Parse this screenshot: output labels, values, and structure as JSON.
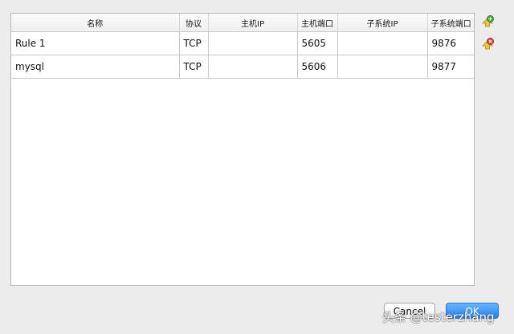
{
  "table": {
    "columns": [
      "名称",
      "协议",
      "主机IP",
      "主机端口",
      "子系统IP",
      "子系统端口"
    ],
    "rows": [
      {
        "name": "Rule 1",
        "protocol": "TCP",
        "host_ip": "",
        "host_port": "5605",
        "guest_ip": "",
        "guest_port": "9876"
      },
      {
        "name": "mysql",
        "protocol": "TCP",
        "host_ip": "",
        "host_port": "5606",
        "guest_ip": "",
        "guest_port": "9877"
      }
    ]
  },
  "side_icons": [
    "add-rule-icon",
    "remove-rule-icon"
  ],
  "buttons": {
    "cancel": "Cancel",
    "ok": "OK"
  },
  "watermark": "头条 @testerzhang",
  "colors": {
    "add_icon": "#3ea53a",
    "remove_icon": "#d9452a",
    "ok_button": "#1f82f4"
  }
}
